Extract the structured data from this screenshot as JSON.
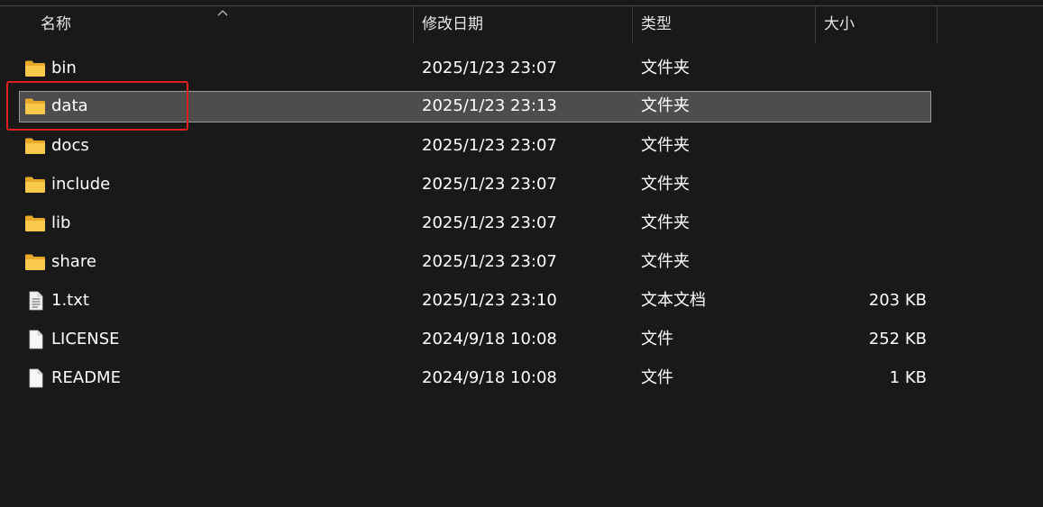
{
  "columns": {
    "name": "名称",
    "date": "修改日期",
    "type": "类型",
    "size": "大小"
  },
  "colors": {
    "background": "#191919",
    "selected_row": "#4d4d4d",
    "folder": "#f5c242",
    "highlight": "#e02020"
  },
  "files": [
    {
      "name": "bin",
      "date": "2025/1/23 23:07",
      "type": "文件夹",
      "size": "",
      "icon": "folder-icon"
    },
    {
      "name": "data",
      "date": "2025/1/23 23:13",
      "type": "文件夹",
      "size": "",
      "icon": "folder-icon",
      "selected": true
    },
    {
      "name": "docs",
      "date": "2025/1/23 23:07",
      "type": "文件夹",
      "size": "",
      "icon": "folder-icon"
    },
    {
      "name": "include",
      "date": "2025/1/23 23:07",
      "type": "文件夹",
      "size": "",
      "icon": "folder-icon"
    },
    {
      "name": "lib",
      "date": "2025/1/23 23:07",
      "type": "文件夹",
      "size": "",
      "icon": "folder-icon"
    },
    {
      "name": "share",
      "date": "2025/1/23 23:07",
      "type": "文件夹",
      "size": "",
      "icon": "folder-icon"
    },
    {
      "name": "1.txt",
      "date": "2025/1/23 23:10",
      "type": "文本文档",
      "size": "203 KB",
      "icon": "text-file-icon"
    },
    {
      "name": "LICENSE",
      "date": "2024/9/18 10:08",
      "type": "文件",
      "size": "252 KB",
      "icon": "file-icon"
    },
    {
      "name": "README",
      "date": "2024/9/18 10:08",
      "type": "文件",
      "size": "1 KB",
      "icon": "file-icon"
    }
  ]
}
